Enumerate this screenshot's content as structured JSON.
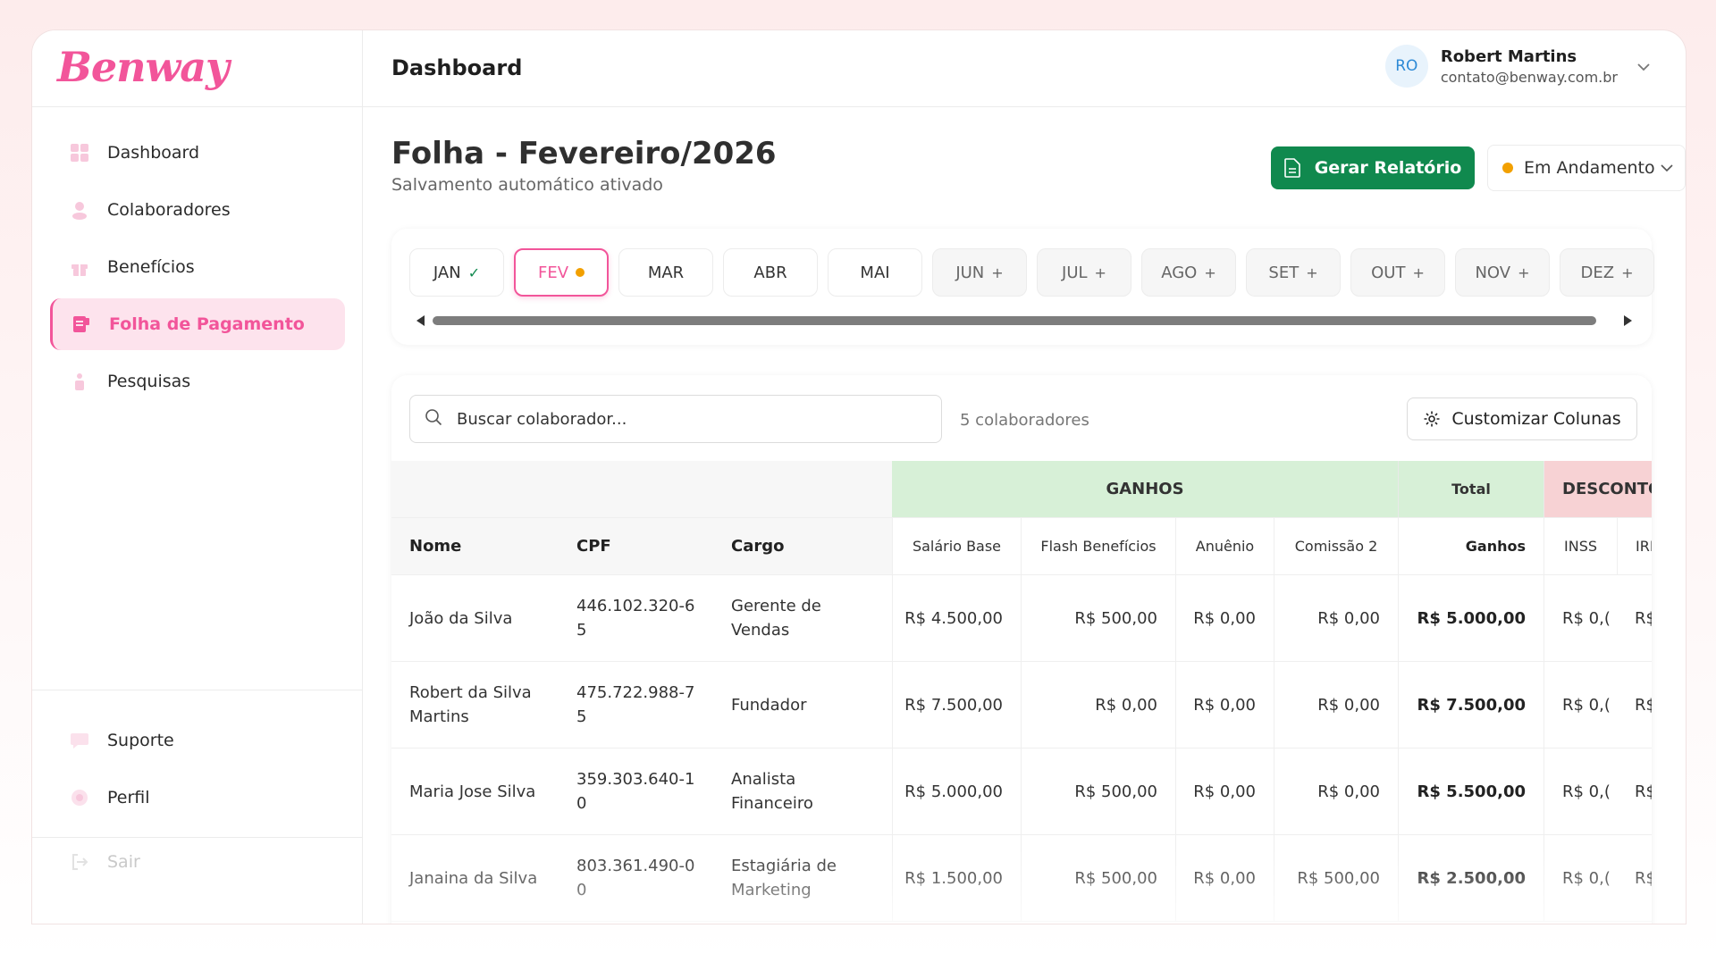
{
  "brand": {
    "logo_text": "Benway",
    "accent": "#f2559a"
  },
  "sidebar": {
    "items": [
      {
        "label": "Dashboard",
        "icon": "grid-icon",
        "active": false
      },
      {
        "label": "Colaboradores",
        "icon": "users-icon",
        "active": false
      },
      {
        "label": "Benefícios",
        "icon": "gift-icon",
        "active": false
      },
      {
        "label": "Folha de Pagamento",
        "icon": "payroll-icon",
        "active": true
      },
      {
        "label": "Pesquisas",
        "icon": "survey-icon",
        "active": false
      }
    ],
    "bottom_items": [
      {
        "label": "Suporte",
        "icon": "chat-icon"
      },
      {
        "label": "Perfil",
        "icon": "user-icon"
      }
    ],
    "logout_label": "Sair"
  },
  "header": {
    "title": "Dashboard",
    "user": {
      "initials": "RO",
      "name": "Robert Martins",
      "email": "contato@benway.com.br"
    }
  },
  "page": {
    "title": "Folha - Fevereiro/2026",
    "subtitle": "Salvamento automático ativado",
    "report_button": "Gerar Relatório",
    "status": {
      "label": "Em Andamento",
      "color": "#f2a000"
    }
  },
  "months": [
    {
      "label": "JAN",
      "state": "done"
    },
    {
      "label": "FEV",
      "state": "active"
    },
    {
      "label": "MAR",
      "state": "open"
    },
    {
      "label": "ABR",
      "state": "open"
    },
    {
      "label": "MAI",
      "state": "open"
    },
    {
      "label": "JUN",
      "state": "future"
    },
    {
      "label": "JUL",
      "state": "future"
    },
    {
      "label": "AGO",
      "state": "future"
    },
    {
      "label": "SET",
      "state": "future"
    },
    {
      "label": "OUT",
      "state": "future"
    },
    {
      "label": "NOV",
      "state": "future"
    },
    {
      "label": "DEZ",
      "state": "future"
    }
  ],
  "table": {
    "search_placeholder": "Buscar colaborador...",
    "count_label": "5 colaboradores",
    "customize_label": "Customizar Colunas",
    "groups": {
      "ganhos": "GANHOS",
      "total": "Total",
      "descontos": "DESCONTO"
    },
    "columns": [
      "Nome",
      "CPF",
      "Cargo",
      "Salário Base",
      "Flash Benefícios",
      "Anuênio",
      "Comissão 2",
      "Ganhos",
      "INSS",
      "IRF"
    ],
    "rows": [
      {
        "nome": "João da Silva",
        "cpf": "446.102.320-65",
        "cargo": "Gerente de Vendas",
        "salario": "R$ 4.500,00",
        "flash": "R$ 500,00",
        "anuenio": "R$ 0,00",
        "comissao": "R$ 0,00",
        "ganhos": "R$ 5.000,00",
        "inss": "R$ 0,(",
        "irf": "R$"
      },
      {
        "nome": "Robert da Silva Martins",
        "cpf": "475.722.988-75",
        "cargo": "Fundador",
        "salario": "R$ 7.500,00",
        "flash": "R$ 0,00",
        "anuenio": "R$ 0,00",
        "comissao": "R$ 0,00",
        "ganhos": "R$ 7.500,00",
        "inss": "R$ 0,(",
        "irf": "R$"
      },
      {
        "nome": "Maria Jose Silva",
        "cpf": "359.303.640-10",
        "cargo": "Analista Financeiro",
        "salario": "R$ 5.000,00",
        "flash": "R$ 500,00",
        "anuenio": "R$ 0,00",
        "comissao": "R$ 0,00",
        "ganhos": "R$ 5.500,00",
        "inss": "R$ 0,(",
        "irf": "R$"
      },
      {
        "nome": "Janaina da Silva",
        "cpf": "803.361.490-00",
        "cargo": "Estagiária de Marketing",
        "salario": "R$ 1.500,00",
        "flash": "R$ 500,00",
        "anuenio": "R$ 0,00",
        "comissao": "R$ 500,00",
        "ganhos": "R$ 2.500,00",
        "inss": "R$ 0,(",
        "irf": "R$"
      }
    ]
  }
}
